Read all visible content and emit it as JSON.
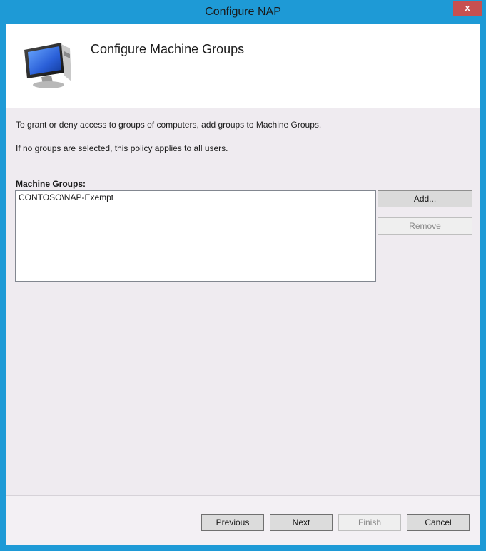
{
  "window": {
    "title": "Configure NAP",
    "close_label": "x"
  },
  "header": {
    "title": "Configure Machine Groups",
    "icon": "computer-monitor-icon"
  },
  "body": {
    "description_1": "To grant or deny access to groups of computers, add groups to Machine Groups.",
    "description_2": "If no groups are selected, this policy applies to all users.",
    "groups_label": "Machine Groups:",
    "groups": [
      "CONTOSO\\NAP-Exempt"
    ]
  },
  "side_buttons": {
    "add_label": "Add...",
    "remove_label": "Remove"
  },
  "footer_buttons": {
    "previous_label": "Previous",
    "next_label": "Next",
    "finish_label": "Finish",
    "cancel_label": "Cancel"
  },
  "colors": {
    "title_bar": "#1e9ad6",
    "close_button": "#c75050",
    "client_background": "#efebf0"
  }
}
